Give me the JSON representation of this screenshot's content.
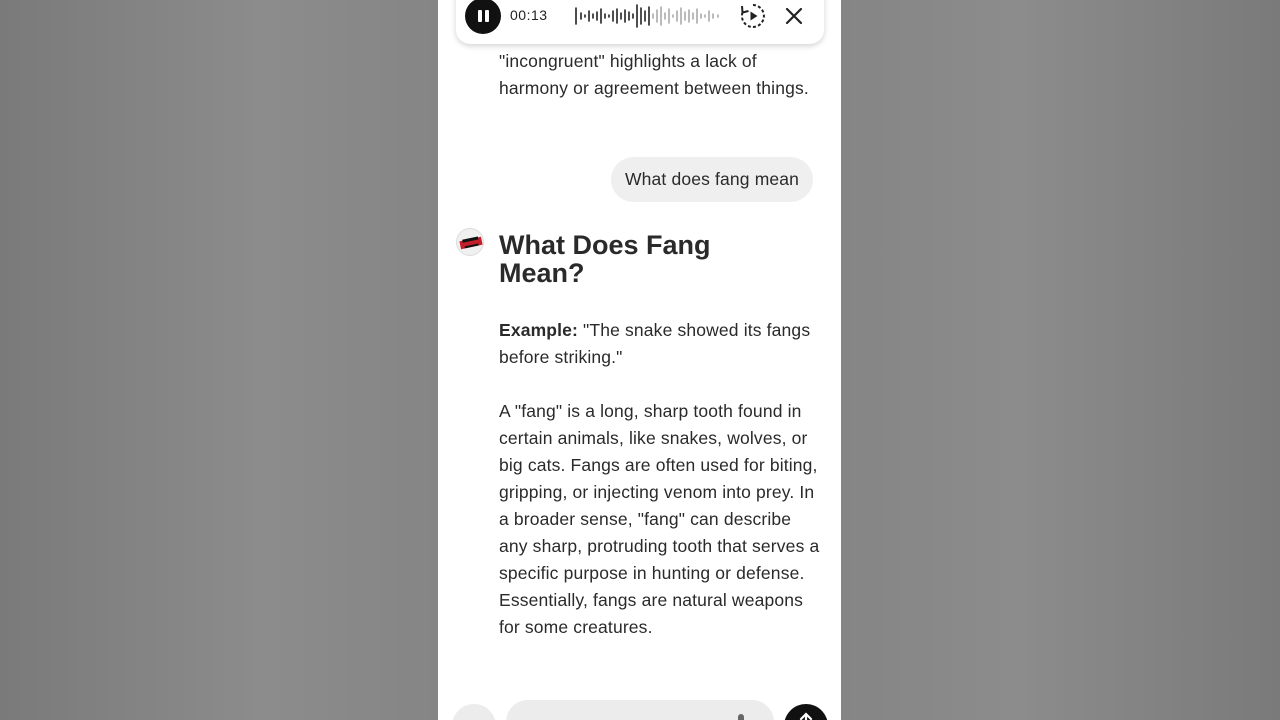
{
  "player": {
    "time": "00:13"
  },
  "conversation": {
    "previous_tail": "\"incongruent\" highlights a lack of harmony or agreement between things.",
    "user_message": "What does fang mean",
    "response": {
      "heading": "What Does Fang Mean?",
      "example_label": "Example:",
      "example_text": " \"The snake showed its fangs before striking.\"",
      "definition": "A \"fang\" is a long, sharp tooth found in certain animals, like snakes, wolves, or big cats. Fangs are often used for biting, gripping, or injecting venom into prey. In a broader sense, \"fang\" can describe any sharp, protruding tooth that serves a specific purpose in hunting or defense. Essentially, fangs are natural weapons for some creatures."
    }
  },
  "icons": {
    "play": "pause-icon",
    "replay": "replay-icon",
    "close": "close-icon",
    "mic": "mic-icon",
    "send": "send-arrow-icon"
  },
  "colors": {
    "background": "#808080",
    "panel": "#ffffff",
    "bubble": "#efefef",
    "text": "#2a2a2a",
    "dark": "#111111"
  }
}
